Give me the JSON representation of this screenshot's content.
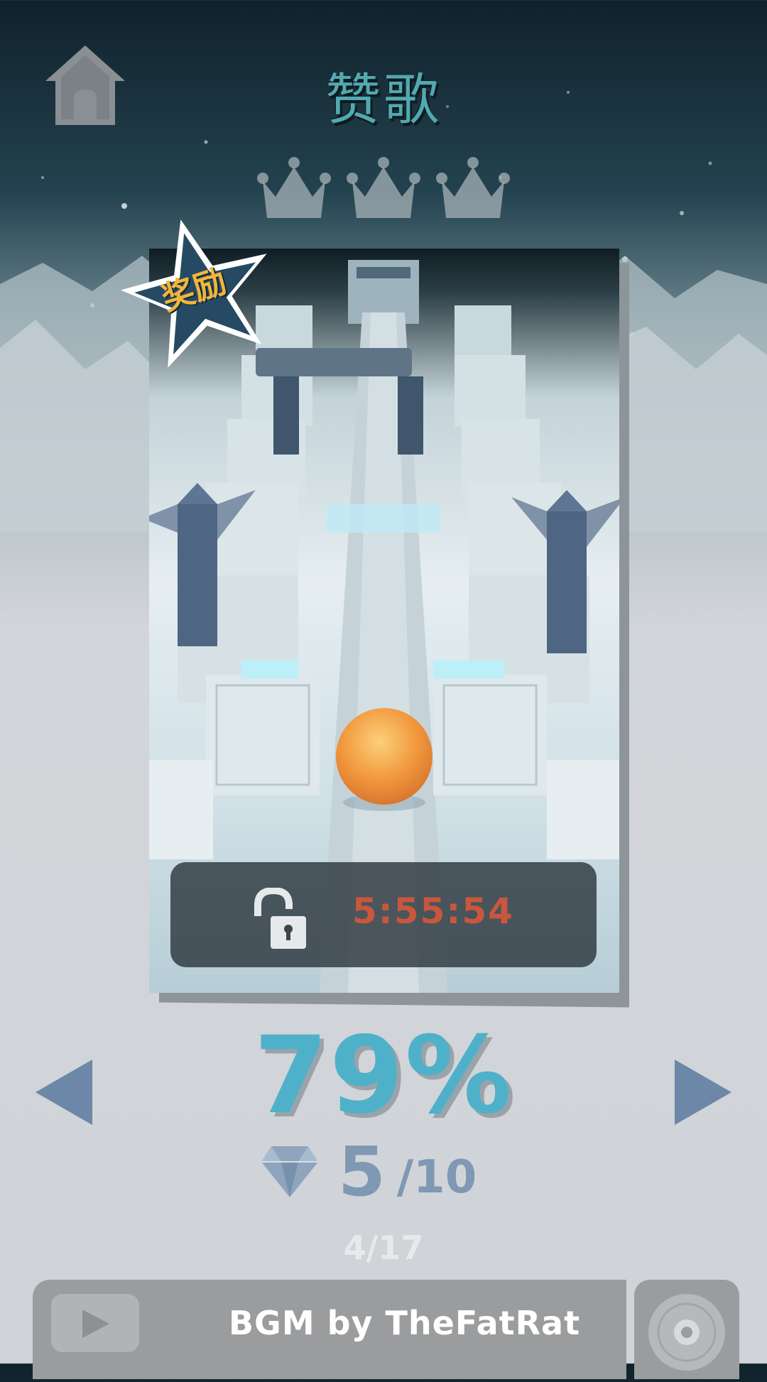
{
  "level": {
    "title": "赞歌",
    "crowns_earned": 0,
    "crowns_total": 3
  },
  "badge": {
    "label": "奖励"
  },
  "lock": {
    "timer": "5:55:54"
  },
  "progress": {
    "percent": "79%",
    "gems_collected": "5",
    "gems_total": "/10",
    "page_index": "4/17"
  },
  "bgm": {
    "text": "BGM by TheFatRat"
  },
  "icons": {
    "home": "home-icon",
    "crown": "crown-icon",
    "lock": "unlock-icon",
    "gem": "diamond-icon",
    "prev": "arrow-left-icon",
    "next": "arrow-right-icon",
    "play": "play-icon",
    "disc": "disc-icon"
  },
  "colors": {
    "percent": "#4fb1c9",
    "timer": "#c9573d",
    "gem": "#7f98b4",
    "badge_text": "#f2b53a",
    "title": "#53a9b0"
  }
}
